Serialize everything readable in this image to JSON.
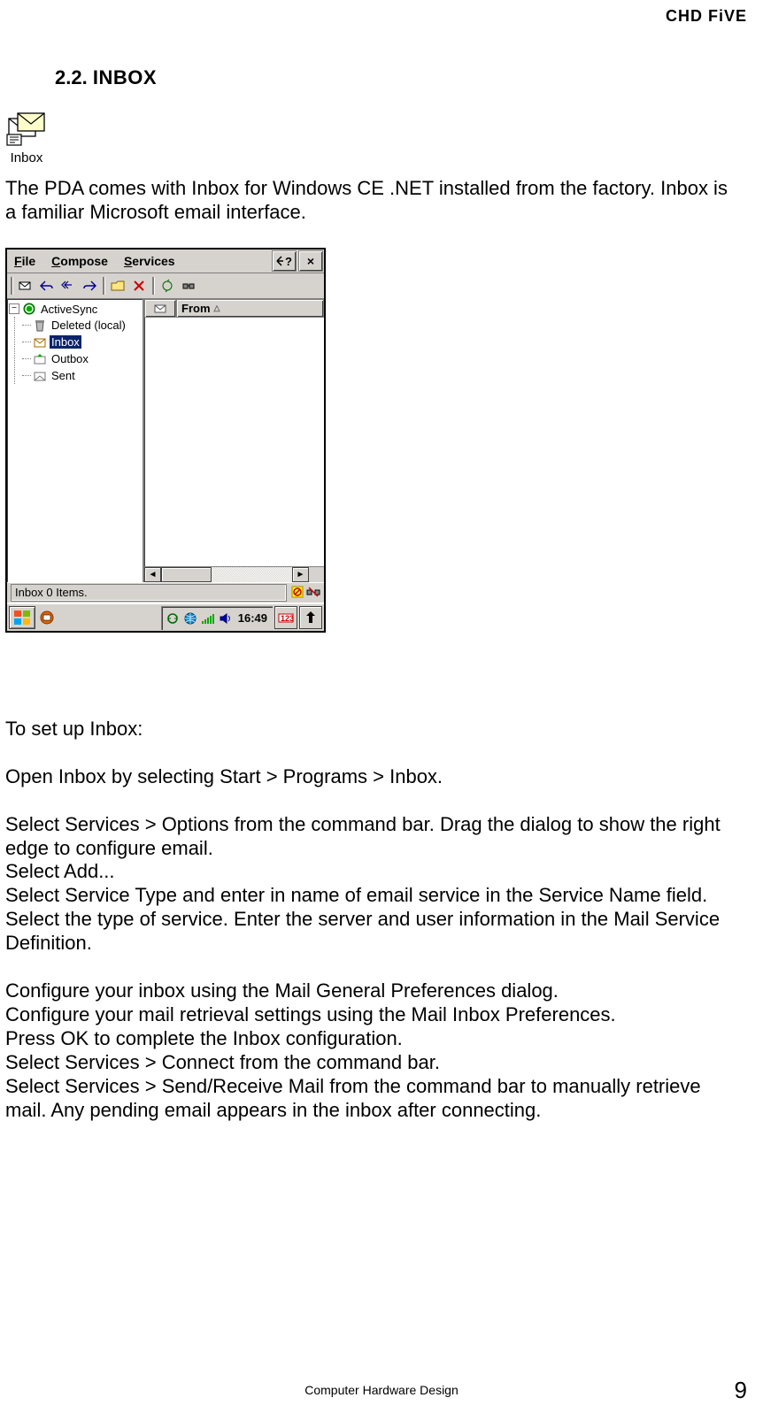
{
  "header_brand": "CHD FiVE",
  "section": {
    "number": "2.2.",
    "title": "INBOX"
  },
  "icon_label": "Inbox",
  "intro": "The PDA comes with Inbox for Windows CE .NET installed from the factory. Inbox is a familiar Microsoft email interface.",
  "ce": {
    "menus": {
      "file": "File",
      "compose": "Compose",
      "services": "Services"
    },
    "help_icon": "?",
    "close_icon": "×",
    "tree": {
      "root": "ActiveSync",
      "items": [
        "Deleted (local)",
        "Inbox",
        "Outbox",
        "Sent"
      ],
      "selected_index": 1
    },
    "list": {
      "col_from": "From"
    },
    "status": "Inbox 0 Items.",
    "clock": "16:49"
  },
  "steps": {
    "setup": "To set up Inbox:",
    "open": "Open Inbox by selecting Start > Programs > Inbox.",
    "options": "Select Services > Options from the command bar. Drag the dialog to show the right edge to configure email.",
    "add": "Select Add...",
    "service_type": "Select Service Type and enter in name of email service in the Service Name field. Select the type of service. Enter the server and user information in the Mail Service Definition.",
    "general_prefs": "Configure your inbox using the Mail General Preferences dialog.",
    "retrieval": "Configure your mail retrieval settings using the Mail Inbox Preferences.",
    "ok": "Press OK to complete the Inbox configuration.",
    "connect": "Select Services > Connect from the command bar.",
    "send_receive": "Select Services > Send/Receive Mail from the command bar to manually retrieve mail. Any pending email appears in the inbox after connecting."
  },
  "footer": "Computer Hardware Design",
  "page": "9"
}
